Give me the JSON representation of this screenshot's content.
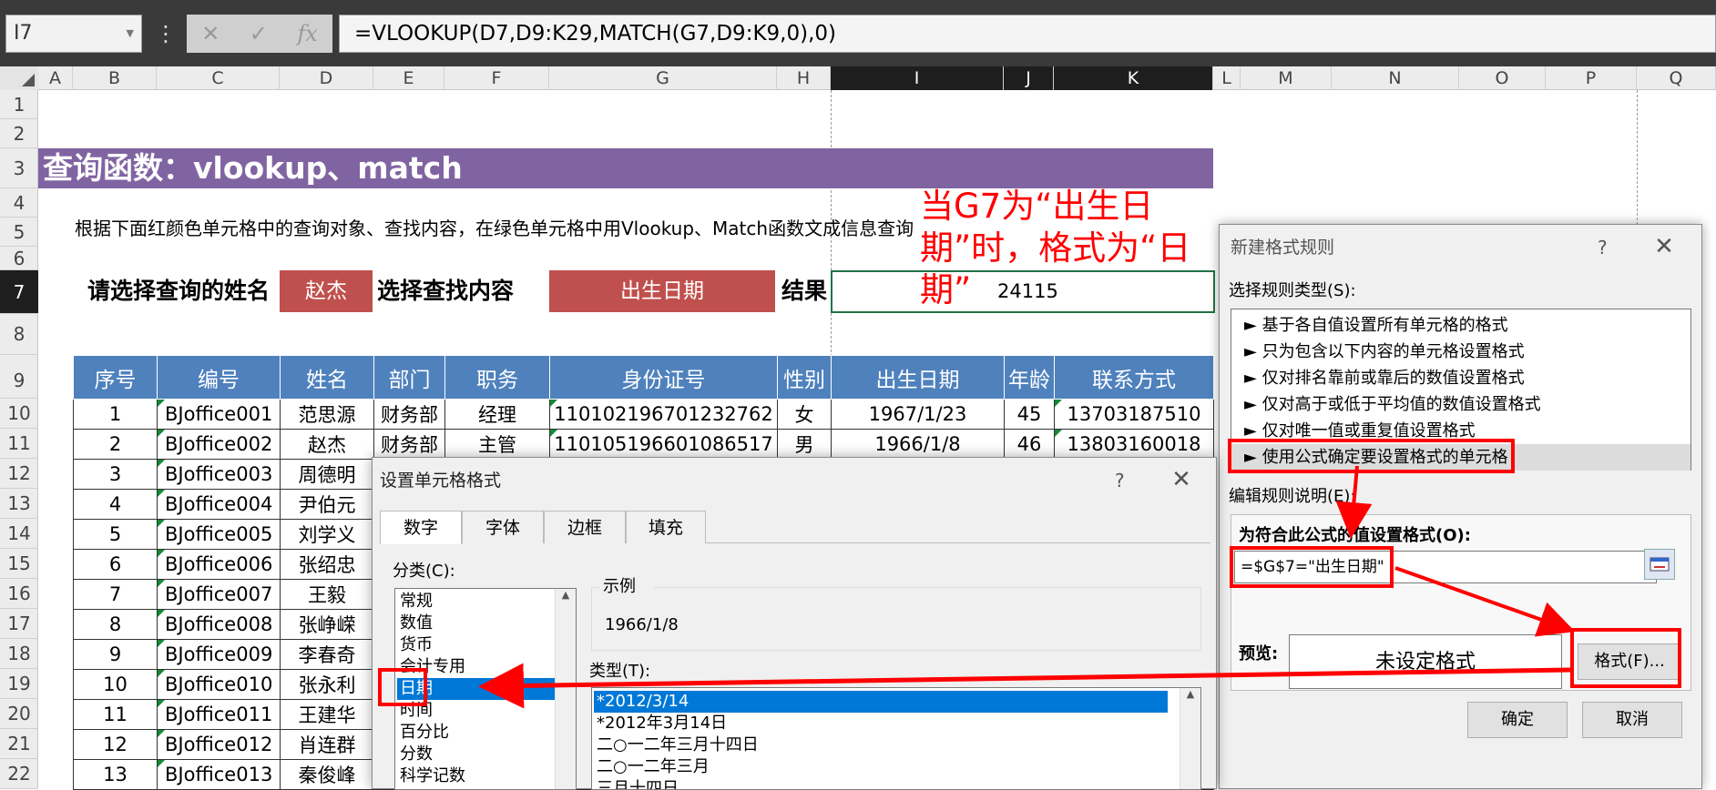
{
  "formula_bar": {
    "name_box": "I7",
    "formula": "=VLOOKUP(D7,D9:K29,MATCH(G7,D9:K9,0),0)",
    "cancel_icon": "✕",
    "enter_icon": "✓",
    "fx_icon": "fx",
    "more_icon": "⋮"
  },
  "columns": [
    "A",
    "B",
    "C",
    "D",
    "E",
    "F",
    "G",
    "H",
    "I",
    "J",
    "K",
    "L",
    "M",
    "N",
    "O",
    "P",
    "Q"
  ],
  "rows": [
    "1",
    "2",
    "3",
    "4",
    "5",
    "6",
    "7",
    "8",
    "9",
    "10",
    "11",
    "12",
    "13",
    "14",
    "15",
    "16",
    "17",
    "18",
    "19",
    "20",
    "21",
    "22"
  ],
  "sheet": {
    "title": "查询函数：vlookup、match",
    "instruction": "根据下面红颜色单元格中的查询对象、查找内容，在绿色单元格中用Vlookup、Match函数文成信息查询",
    "name_label": "请选择查询的姓名",
    "name_value": "赵杰",
    "find_label": "选择查找内容",
    "find_value": "出生日期",
    "result_label": "结果",
    "result_value": "24115",
    "annotation": "当G7为“出生日期”时，格式为“日期”"
  },
  "table": {
    "headers": [
      "序号",
      "编号",
      "姓名",
      "部门",
      "职务",
      "身份证号",
      "性别",
      "出生日期",
      "年龄",
      "联系方式"
    ],
    "rows": [
      [
        "1",
        "BJoffice001",
        "范思源",
        "财务部",
        "经理",
        "110102196701232762",
        "女",
        "1967/1/23",
        "45",
        "13703187510"
      ],
      [
        "2",
        "BJoffice002",
        "赵杰",
        "财务部",
        "主管",
        "110105196601086517",
        "男",
        "1966/1/8",
        "46",
        "13803160018"
      ],
      [
        "3",
        "BJoffice003",
        "周德明",
        "",
        "",
        "",
        "",
        "",
        "",
        ""
      ],
      [
        "4",
        "BJoffice004",
        "尹伯元",
        "",
        "",
        "",
        "",
        "",
        "",
        ""
      ],
      [
        "5",
        "BJoffice005",
        "刘学义",
        "",
        "",
        "",
        "",
        "",
        "",
        ""
      ],
      [
        "6",
        "BJoffice006",
        "张绍忠",
        "",
        "",
        "",
        "",
        "",
        "",
        ""
      ],
      [
        "7",
        "BJoffice007",
        "王毅",
        "",
        "",
        "",
        "",
        "",
        "",
        ""
      ],
      [
        "8",
        "BJoffice008",
        "张峥嵘",
        "",
        "",
        "",
        "",
        "",
        "",
        ""
      ],
      [
        "9",
        "BJoffice009",
        "李春奇",
        "",
        "",
        "",
        "",
        "",
        "",
        ""
      ],
      [
        "10",
        "BJoffice010",
        "张永利",
        "",
        "",
        "",
        "",
        "",
        "",
        ""
      ],
      [
        "11",
        "BJoffice011",
        "王建华",
        "",
        "",
        "",
        "",
        "",
        "",
        ""
      ],
      [
        "12",
        "BJoffice012",
        "肖连群",
        "",
        "",
        "",
        "",
        "",
        "",
        ""
      ],
      [
        "13",
        "BJoffice013",
        "秦俊峰",
        "",
        "",
        "",
        "",
        "",
        "",
        ""
      ]
    ]
  },
  "new_rule_dialog": {
    "title": "新建格式规则",
    "help": "?",
    "close": "✕",
    "select_type_label": "选择规则类型(S):",
    "rule_types": [
      "► 基于各自值设置所有单元格的格式",
      "► 只为包含以下内容的单元格设置格式",
      "► 仅对排名靠前或靠后的数值设置格式",
      "► 仅对高于或低于平均值的数值设置格式",
      "► 仅对唯一值或重复值设置格式",
      "► 使用公式确定要设置格式的单元格"
    ],
    "edit_label": "编辑规则说明(E):",
    "formula_label": "为符合此公式的值设置格式(O):",
    "formula_value": "=$G$7=\"出生日期\"",
    "preview_label": "预览:",
    "preview_text": "未设定格式",
    "format_button": "格式(F)...",
    "ok_button": "确定",
    "cancel_button": "取消"
  },
  "format_cells_dialog": {
    "title": "设置单元格格式",
    "help": "?",
    "close": "✕",
    "tabs": [
      "数字",
      "字体",
      "边框",
      "填充"
    ],
    "category_label": "分类(C):",
    "categories": [
      "常规",
      "数值",
      "货币",
      "会计专用",
      "日期",
      "时间",
      "百分比",
      "分数",
      "科学记数"
    ],
    "sample_label": "示例",
    "sample_value": "1966/1/8",
    "type_label": "类型(T):",
    "types": [
      "*2012/3/14",
      "*2012年3月14日",
      "二○一二年三月十四日",
      "二○一二年三月",
      "三月十四日"
    ]
  },
  "colors": {
    "title_bg": "#8064a2",
    "red_cell": "#c0504d",
    "table_header": "#4f81bd",
    "annotation": "#ff0000",
    "selection": "#0078d7"
  }
}
